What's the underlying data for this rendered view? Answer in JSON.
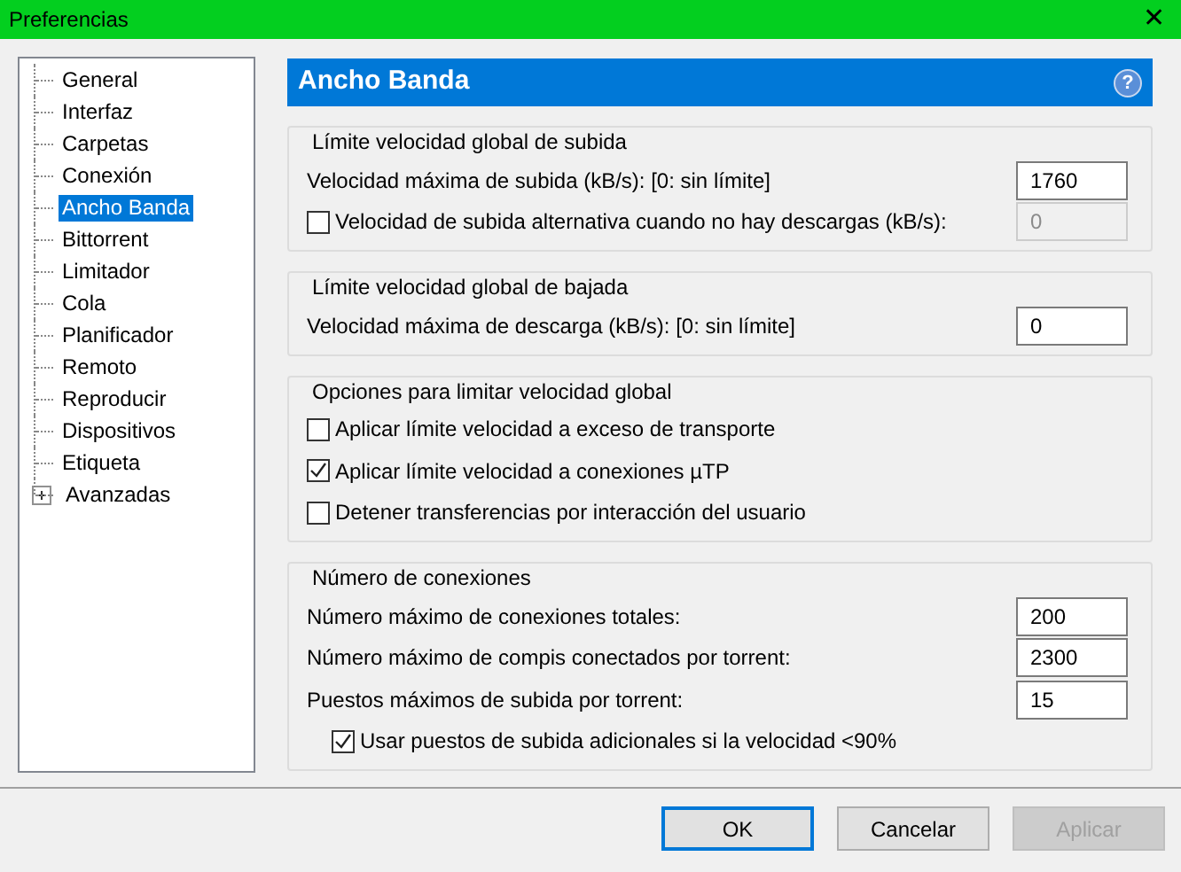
{
  "window": {
    "title": "Preferencias",
    "close": "✕"
  },
  "sidebar": {
    "items": [
      {
        "label": "General",
        "selected": false
      },
      {
        "label": "Interfaz",
        "selected": false
      },
      {
        "label": "Carpetas",
        "selected": false
      },
      {
        "label": "Conexión",
        "selected": false
      },
      {
        "label": "Ancho Banda",
        "selected": true
      },
      {
        "label": "Bittorrent",
        "selected": false
      },
      {
        "label": "Limitador",
        "selected": false
      },
      {
        "label": "Cola",
        "selected": false
      },
      {
        "label": "Planificador",
        "selected": false
      },
      {
        "label": "Remoto",
        "selected": false
      },
      {
        "label": "Reproducir",
        "selected": false
      },
      {
        "label": "Dispositivos",
        "selected": false
      },
      {
        "label": "Etiqueta",
        "selected": false
      },
      {
        "label": "Avanzadas",
        "selected": false,
        "expanded": false
      }
    ]
  },
  "header": {
    "title": "Ancho Banda",
    "help": "?"
  },
  "groups": [
    {
      "title": "Límite velocidad global de subida",
      "rows": [
        {
          "kind": "input",
          "label": "Velocidad máxima de subida (kB/s): [0: sin límite]",
          "value": "1760",
          "disabled": false
        },
        {
          "kind": "checkbox_input",
          "label": "Velocidad de subida alternativa cuando no hay descargas (kB/s):",
          "checked": false,
          "value": "0",
          "disabled": true
        }
      ]
    },
    {
      "title": "Límite velocidad global de bajada",
      "rows": [
        {
          "kind": "input",
          "label": "Velocidad máxima de descarga (kB/s): [0: sin límite]",
          "value": "0",
          "disabled": false
        }
      ]
    },
    {
      "title": "Opciones para limitar velocidad global",
      "rows": [
        {
          "kind": "checkbox",
          "label": "Aplicar límite velocidad a exceso de transporte",
          "checked": false
        },
        {
          "kind": "checkbox",
          "label": "Aplicar límite velocidad a conexiones µTP",
          "checked": true
        },
        {
          "kind": "checkbox",
          "label": "Detener transferencias por interacción del usuario",
          "checked": false
        }
      ]
    },
    {
      "title": "Número de conexiones",
      "rows": [
        {
          "kind": "input",
          "label": "Número máximo de conexiones totales:",
          "value": "200",
          "disabled": false
        },
        {
          "kind": "input",
          "label": "Número máximo de compis conectados por torrent:",
          "value": "2300",
          "disabled": false
        },
        {
          "kind": "input",
          "label": "Puestos máximos de subida por torrent:",
          "value": "15",
          "disabled": false
        },
        {
          "kind": "sub_checkbox",
          "label": "Usar puestos de subida adicionales si la velocidad <90%",
          "checked": true
        }
      ]
    }
  ],
  "buttons": [
    {
      "label": "OK",
      "default": true,
      "disabled": false
    },
    {
      "label": "Cancelar",
      "default": false,
      "disabled": false
    },
    {
      "label": "Aplicar",
      "default": false,
      "disabled": true
    }
  ]
}
